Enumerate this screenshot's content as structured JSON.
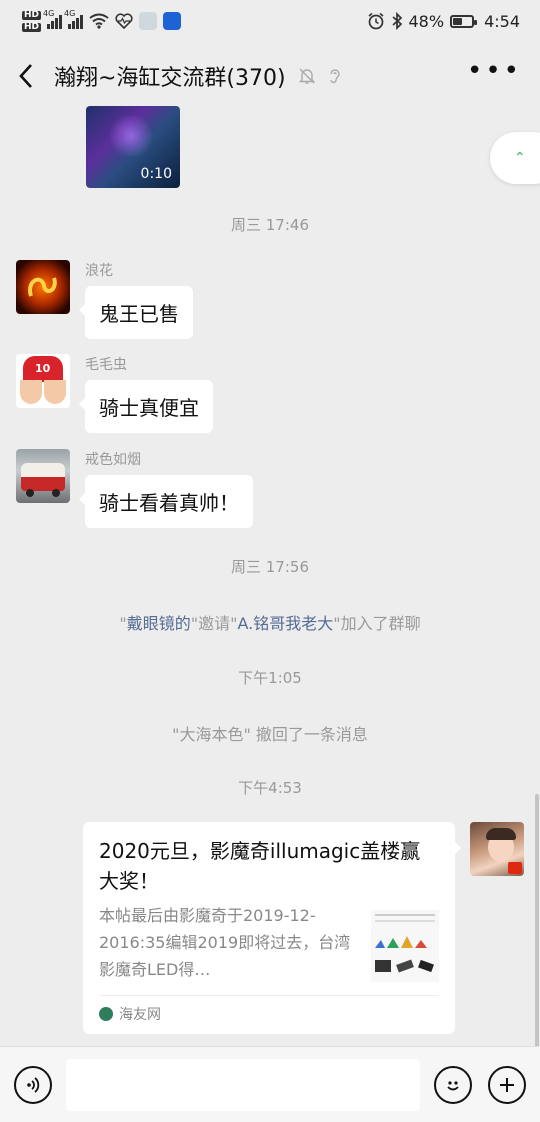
{
  "status_bar": {
    "hd1": "HD",
    "hd2": "HD",
    "net1": "4G",
    "net2": "4G",
    "battery_pct": "48%",
    "battery_level": 0.48,
    "time": "4:54"
  },
  "header": {
    "title": "瀚翔~海缸交流群(370)"
  },
  "chat": {
    "video_duration": "0:10",
    "time_1": "周三 17:46",
    "messages": [
      {
        "sender": "浪花",
        "text": "鬼王已售"
      },
      {
        "sender": "毛毛虫",
        "text": "骑士真便宜"
      },
      {
        "sender": "戒色如烟",
        "text": "骑士看着真帅！"
      }
    ],
    "time_2": "周三 17:56",
    "invite": {
      "q1": "\"",
      "inviter": "戴眼镜的",
      "mid": "\"邀请\"",
      "invitee": "A.铭哥我老大",
      "tail": "\"加入了群聊"
    },
    "time_3": "下午1:05",
    "recall": "\"大海本色\" 撤回了一条消息",
    "time_4": "下午4:53",
    "avatar_num": "10"
  },
  "link_card": {
    "title": "2020元旦，影魔奇illumagic盖楼赢大奖！",
    "desc": "本帖最后由影魔奇于2019-12-2016:35编辑2019即将过去，台湾影魔奇LED得…",
    "source": "海友网"
  }
}
